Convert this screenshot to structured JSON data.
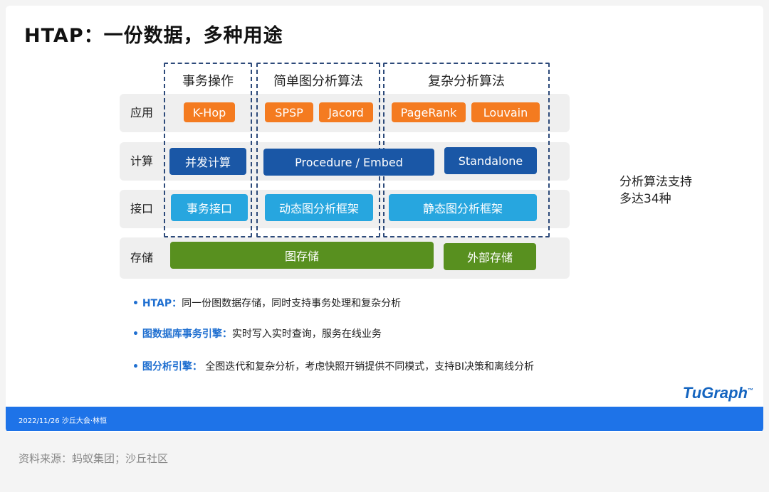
{
  "title": "HTAP：一份数据，多种用途",
  "columns": {
    "tx": "事务操作",
    "simple": "简单图分析算法",
    "complex": "复杂分析算法"
  },
  "rows": {
    "app": "应用",
    "compute": "计算",
    "interface": "接口",
    "storage": "存储"
  },
  "boxes": {
    "khop": "K-Hop",
    "spsp": "SPSP",
    "jacord": "Jacord",
    "pagerank": "PageRank",
    "louvain": "Louvain",
    "concurrent": "并发计算",
    "procedure": "Procedure / Embed",
    "standalone": "Standalone",
    "tx_interface": "事务接口",
    "dynamic_framework": "动态图分析框架",
    "static_framework": "静态图分析框架",
    "graph_storage": "图存储",
    "external_storage": "外部存储"
  },
  "side_note": {
    "line1": "分析算法支持",
    "line2": "多达34种"
  },
  "bullets": [
    {
      "key": "• HTAP：",
      "text": "同一份图数据存储，同时支持事务处理和复杂分析"
    },
    {
      "key": "• 图数据库事务引擎：",
      "text": "实时写入实时查询，服务在线业务"
    },
    {
      "key": "• 图分析引擎：",
      "text": " 全图迭代和复杂分析，考虑快照开销提供不同模式，支持BI决策和离线分析"
    }
  ],
  "logo": {
    "text": "TuGraph",
    "tm": "™"
  },
  "footer": "2022/11/26 沙丘大会·林恒",
  "source": "资料来源：蚂蚁集团；沙丘社区",
  "colors": {
    "orange": "#f47b20",
    "navy": "#1a57a6",
    "sky": "#27a6df",
    "green": "#58901f",
    "footer_blue": "#1e73e8",
    "accent_text": "#1f6fd0"
  }
}
